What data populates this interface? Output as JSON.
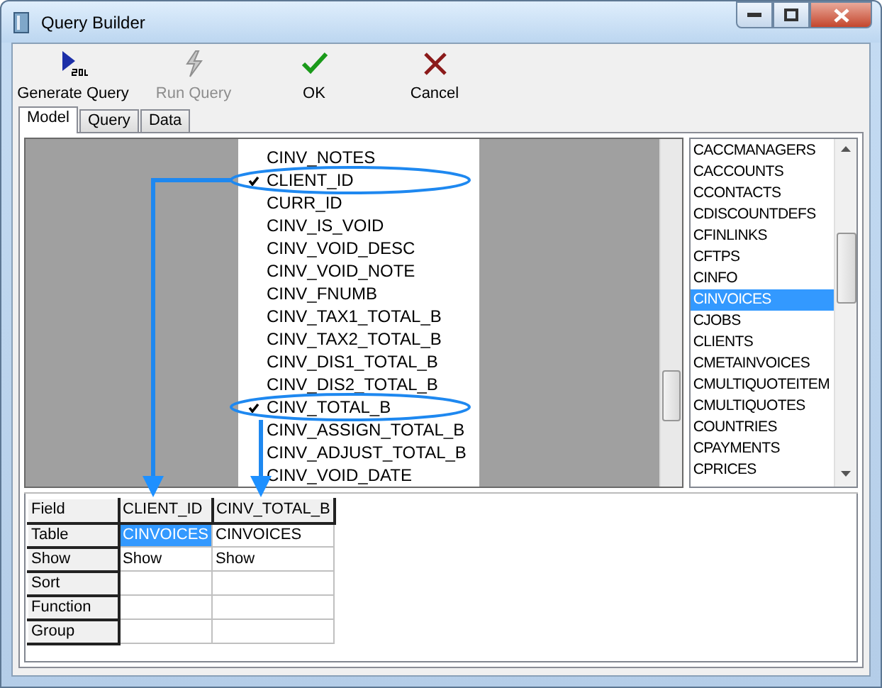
{
  "window": {
    "title": "Query Builder"
  },
  "toolbar": [
    {
      "label": "Generate Query",
      "kind": "sql",
      "disabled": false
    },
    {
      "label": "Run Query",
      "kind": "run",
      "disabled": true
    },
    {
      "label": "OK",
      "kind": "ok",
      "disabled": false
    },
    {
      "label": "Cancel",
      "kind": "cancel",
      "disabled": false
    }
  ],
  "tabs": [
    {
      "label": "Model",
      "selected": true
    },
    {
      "label": "Query",
      "selected": false
    },
    {
      "label": "Data",
      "selected": false
    }
  ],
  "fields": [
    {
      "name": "CINV_NOTES",
      "checked": false
    },
    {
      "name": "CLIENT_ID",
      "checked": true
    },
    {
      "name": "CURR_ID",
      "checked": false
    },
    {
      "name": "CINV_IS_VOID",
      "checked": false
    },
    {
      "name": "CINV_VOID_DESC",
      "checked": false
    },
    {
      "name": "CINV_VOID_NOTE",
      "checked": false
    },
    {
      "name": "CINV_FNUMB",
      "checked": false
    },
    {
      "name": "CINV_TAX1_TOTAL_B",
      "checked": false
    },
    {
      "name": "CINV_TAX2_TOTAL_B",
      "checked": false
    },
    {
      "name": "CINV_DIS1_TOTAL_B",
      "checked": false
    },
    {
      "name": "CINV_DIS2_TOTAL_B",
      "checked": false
    },
    {
      "name": "CINV_TOTAL_B",
      "checked": true
    },
    {
      "name": "CINV_ASSIGN_TOTAL_B",
      "checked": false
    },
    {
      "name": "CINV_ADJUST_TOTAL_B",
      "checked": false
    },
    {
      "name": "CINV_VOID_DATE",
      "checked": false
    }
  ],
  "tables": [
    {
      "name": "CACCMANAGERS",
      "selected": false
    },
    {
      "name": "CACCOUNTS",
      "selected": false
    },
    {
      "name": "CCONTACTS",
      "selected": false
    },
    {
      "name": "CDISCOUNTDEFS",
      "selected": false
    },
    {
      "name": "CFINLINKS",
      "selected": false
    },
    {
      "name": "CFTPS",
      "selected": false
    },
    {
      "name": "CINFO",
      "selected": false
    },
    {
      "name": "CINVOICES",
      "selected": true
    },
    {
      "name": "CJOBS",
      "selected": false
    },
    {
      "name": "CLIENTS",
      "selected": false
    },
    {
      "name": "CMETAINVOICES",
      "selected": false
    },
    {
      "name": "CMULTIQUOTEITEM",
      "selected": false
    },
    {
      "name": "CMULTIQUOTES",
      "selected": false
    },
    {
      "name": "COUNTRIES",
      "selected": false
    },
    {
      "name": "CPAYMENTS",
      "selected": false
    },
    {
      "name": "CPRICES",
      "selected": false
    }
  ],
  "grid": [
    {
      "label": "Field",
      "header": true,
      "cells": [
        {
          "text": "CLIENT_ID",
          "selected": false
        },
        {
          "text": "CINV_TOTAL_B",
          "selected": false
        }
      ]
    },
    {
      "label": "Table",
      "header": false,
      "cells": [
        {
          "text": "CINVOICES",
          "selected": true
        },
        {
          "text": "CINVOICES",
          "selected": false
        }
      ]
    },
    {
      "label": "Show",
      "header": false,
      "cells": [
        {
          "text": "Show",
          "selected": false
        },
        {
          "text": "Show",
          "selected": false
        }
      ]
    },
    {
      "label": "Sort",
      "header": false,
      "cells": [
        {
          "selected": false
        },
        {
          "selected": false
        }
      ]
    },
    {
      "label": "Function",
      "header": false,
      "cells": [
        {
          "selected": false
        },
        {
          "selected": false
        }
      ]
    },
    {
      "label": "Group",
      "header": false,
      "cells": [
        {
          "selected": false
        },
        {
          "selected": false
        }
      ]
    }
  ]
}
